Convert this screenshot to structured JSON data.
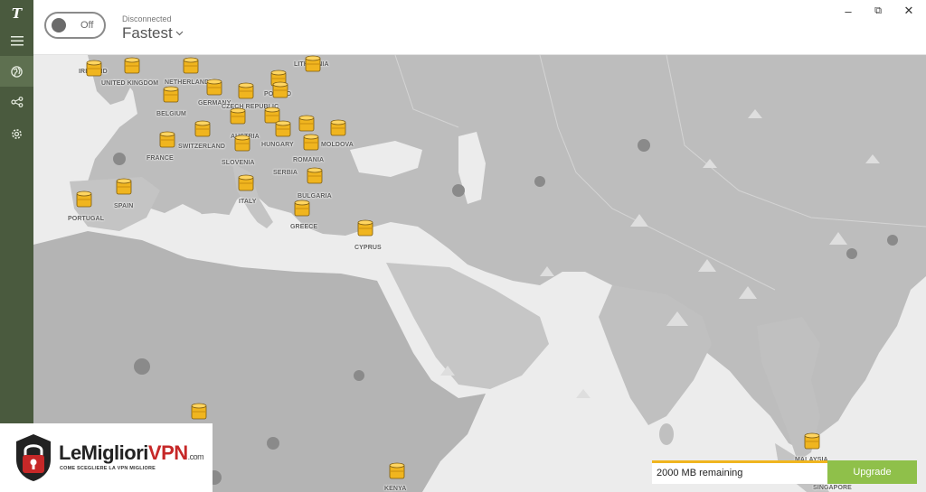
{
  "sidebar": {
    "items": [
      {
        "name": "menu",
        "icon": "hamburger-icon"
      },
      {
        "name": "map",
        "icon": "globe-icon"
      },
      {
        "name": "share",
        "icon": "share-icon"
      },
      {
        "name": "settings",
        "icon": "gear-icon"
      }
    ]
  },
  "header": {
    "toggle_label": "Off",
    "status": "Disconnected",
    "location": "Fastest"
  },
  "window_controls": {
    "minimize": "–",
    "restore": "⧉",
    "close": "✕"
  },
  "map": {
    "labels": [
      {
        "text": "IRELAND"
      },
      {
        "text": "UNITED KINGDOM"
      },
      {
        "text": "NETHERLANDS"
      },
      {
        "text": "LITHUANIA"
      },
      {
        "text": "POLAND"
      },
      {
        "text": "BELGIUM"
      },
      {
        "text": "GERMANY"
      },
      {
        "text": "CZECH REPUBLIC"
      },
      {
        "text": "AUSTRIA"
      },
      {
        "text": "SWITZERLAND"
      },
      {
        "text": "HUNGARY"
      },
      {
        "text": "MOLDOVA"
      },
      {
        "text": "ROMANIA"
      },
      {
        "text": "FRANCE"
      },
      {
        "text": "SLOVENIA"
      },
      {
        "text": "SERBIA"
      },
      {
        "text": "BULGARIA"
      },
      {
        "text": "PORTUGAL"
      },
      {
        "text": "SPAIN"
      },
      {
        "text": "ITALY"
      },
      {
        "text": "GREECE"
      },
      {
        "text": "CYPRUS"
      },
      {
        "text": "KENYA"
      },
      {
        "text": "MALAYSIA"
      },
      {
        "text": "SINGAPORE"
      }
    ]
  },
  "footer": {
    "data_remaining": "2000 MB remaining",
    "upgrade_label": "Upgrade"
  },
  "watermark": {
    "brand_main": "LeMigliori",
    "brand_accent": "VPN",
    "brand_suffix": ".com",
    "tagline": "COME SCEGLIERE LA VPN MIGLIORE"
  },
  "colors": {
    "sidebar": "#4a5a3e",
    "barrel": "#f0b51f",
    "upgrade": "#8fc04a",
    "data_bar_accent": "#f0b51f"
  }
}
